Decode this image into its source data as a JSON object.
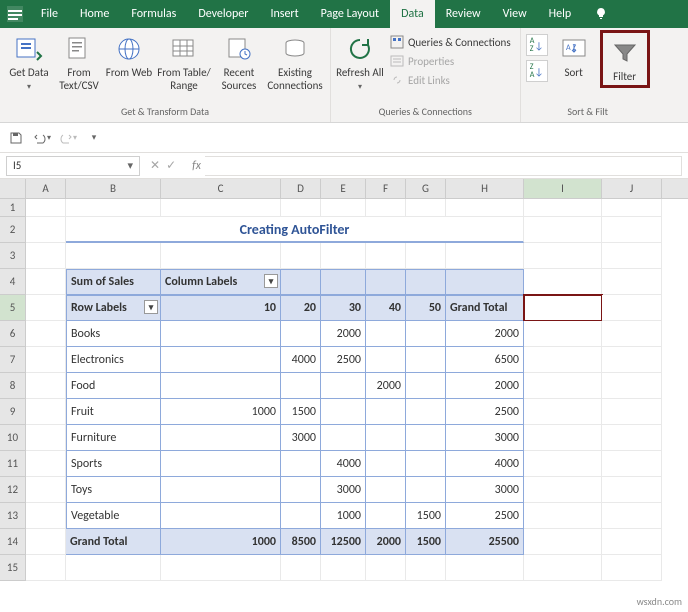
{
  "menu": {
    "tabs": [
      "File",
      "Home",
      "Formulas",
      "Developer",
      "Insert",
      "Page Layout",
      "Data",
      "Review",
      "View",
      "Help"
    ],
    "active": "Data"
  },
  "ribbon": {
    "groups": {
      "transform": {
        "label": "Get & Transform Data",
        "buttons": {
          "get_data": "Get Data",
          "from_text": "From Text/CSV",
          "from_web": "From Web",
          "from_table": "From Table/ Range",
          "recent": "Recent Sources",
          "existing": "Existing Connections"
        }
      },
      "connections": {
        "label": "Queries & Connections",
        "refresh": "Refresh All",
        "queries": "Queries & Connections",
        "properties": "Properties",
        "edit_links": "Edit Links"
      },
      "sortfilter": {
        "label": "Sort & Filt",
        "sort": "Sort",
        "filter": "Filter",
        "az": "A→Z",
        "za": "Z→A"
      }
    }
  },
  "namebox": "I5",
  "title": "Creating AutoFilter",
  "pivot": {
    "sum_label": "Sum of Sales",
    "col_label": "Column Labels",
    "row_label": "Row Labels",
    "cols": [
      "10",
      "20",
      "30",
      "40",
      "50"
    ],
    "gt_label": "Grand Total",
    "rows": [
      {
        "label": "Books",
        "v": [
          "",
          "",
          "2000",
          "",
          ""
        ],
        "gt": "2000"
      },
      {
        "label": "Electronics",
        "v": [
          "",
          "4000",
          "2500",
          "",
          ""
        ],
        "gt": "6500"
      },
      {
        "label": "Food",
        "v": [
          "",
          "",
          "",
          "2000",
          ""
        ],
        "gt": "2000"
      },
      {
        "label": "Fruit",
        "v": [
          "1000",
          "1500",
          "",
          "",
          ""
        ],
        "gt": "2500"
      },
      {
        "label": "Furniture",
        "v": [
          "",
          "3000",
          "",
          "",
          ""
        ],
        "gt": "3000"
      },
      {
        "label": "Sports",
        "v": [
          "",
          "",
          "4000",
          "",
          ""
        ],
        "gt": "4000"
      },
      {
        "label": "Toys",
        "v": [
          "",
          "",
          "3000",
          "",
          ""
        ],
        "gt": "3000"
      },
      {
        "label": "Vegetable",
        "v": [
          "",
          "",
          "1000",
          "",
          "1500"
        ],
        "gt": "2500"
      }
    ],
    "grand_total_row": {
      "label": "Grand Total",
      "v": [
        "1000",
        "8500",
        "12500",
        "2000",
        "1500"
      ],
      "gt": "25500"
    }
  },
  "watermark": "wsxdn.com"
}
